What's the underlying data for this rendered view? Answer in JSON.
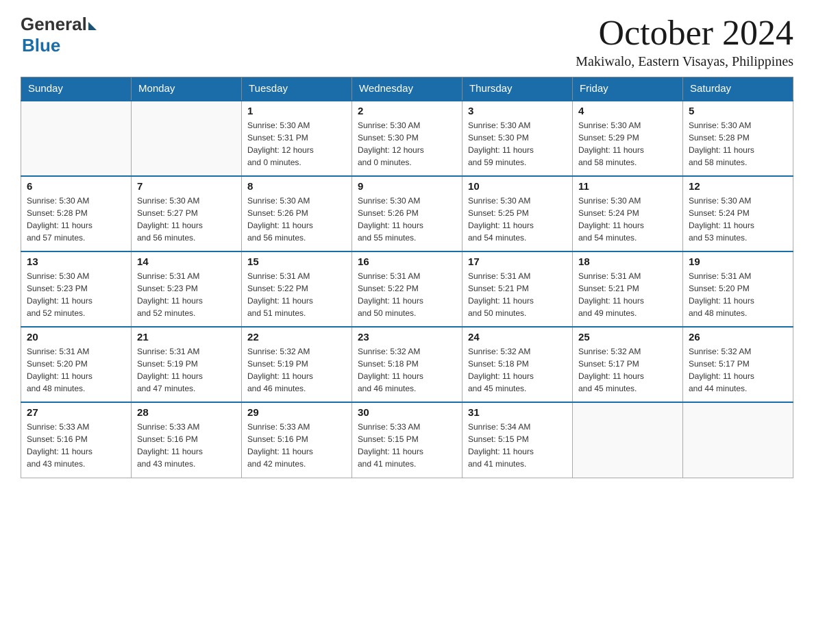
{
  "header": {
    "logo": {
      "general": "General",
      "blue": "Blue"
    },
    "title": "October 2024",
    "subtitle": "Makiwalo, Eastern Visayas, Philippines"
  },
  "calendar": {
    "days_of_week": [
      "Sunday",
      "Monday",
      "Tuesday",
      "Wednesday",
      "Thursday",
      "Friday",
      "Saturday"
    ],
    "weeks": [
      {
        "days": [
          {
            "number": "",
            "info": ""
          },
          {
            "number": "",
            "info": ""
          },
          {
            "number": "1",
            "info": "Sunrise: 5:30 AM\nSunset: 5:31 PM\nDaylight: 12 hours\nand 0 minutes."
          },
          {
            "number": "2",
            "info": "Sunrise: 5:30 AM\nSunset: 5:30 PM\nDaylight: 12 hours\nand 0 minutes."
          },
          {
            "number": "3",
            "info": "Sunrise: 5:30 AM\nSunset: 5:30 PM\nDaylight: 11 hours\nand 59 minutes."
          },
          {
            "number": "4",
            "info": "Sunrise: 5:30 AM\nSunset: 5:29 PM\nDaylight: 11 hours\nand 58 minutes."
          },
          {
            "number": "5",
            "info": "Sunrise: 5:30 AM\nSunset: 5:28 PM\nDaylight: 11 hours\nand 58 minutes."
          }
        ]
      },
      {
        "days": [
          {
            "number": "6",
            "info": "Sunrise: 5:30 AM\nSunset: 5:28 PM\nDaylight: 11 hours\nand 57 minutes."
          },
          {
            "number": "7",
            "info": "Sunrise: 5:30 AM\nSunset: 5:27 PM\nDaylight: 11 hours\nand 56 minutes."
          },
          {
            "number": "8",
            "info": "Sunrise: 5:30 AM\nSunset: 5:26 PM\nDaylight: 11 hours\nand 56 minutes."
          },
          {
            "number": "9",
            "info": "Sunrise: 5:30 AM\nSunset: 5:26 PM\nDaylight: 11 hours\nand 55 minutes."
          },
          {
            "number": "10",
            "info": "Sunrise: 5:30 AM\nSunset: 5:25 PM\nDaylight: 11 hours\nand 54 minutes."
          },
          {
            "number": "11",
            "info": "Sunrise: 5:30 AM\nSunset: 5:24 PM\nDaylight: 11 hours\nand 54 minutes."
          },
          {
            "number": "12",
            "info": "Sunrise: 5:30 AM\nSunset: 5:24 PM\nDaylight: 11 hours\nand 53 minutes."
          }
        ]
      },
      {
        "days": [
          {
            "number": "13",
            "info": "Sunrise: 5:30 AM\nSunset: 5:23 PM\nDaylight: 11 hours\nand 52 minutes."
          },
          {
            "number": "14",
            "info": "Sunrise: 5:31 AM\nSunset: 5:23 PM\nDaylight: 11 hours\nand 52 minutes."
          },
          {
            "number": "15",
            "info": "Sunrise: 5:31 AM\nSunset: 5:22 PM\nDaylight: 11 hours\nand 51 minutes."
          },
          {
            "number": "16",
            "info": "Sunrise: 5:31 AM\nSunset: 5:22 PM\nDaylight: 11 hours\nand 50 minutes."
          },
          {
            "number": "17",
            "info": "Sunrise: 5:31 AM\nSunset: 5:21 PM\nDaylight: 11 hours\nand 50 minutes."
          },
          {
            "number": "18",
            "info": "Sunrise: 5:31 AM\nSunset: 5:21 PM\nDaylight: 11 hours\nand 49 minutes."
          },
          {
            "number": "19",
            "info": "Sunrise: 5:31 AM\nSunset: 5:20 PM\nDaylight: 11 hours\nand 48 minutes."
          }
        ]
      },
      {
        "days": [
          {
            "number": "20",
            "info": "Sunrise: 5:31 AM\nSunset: 5:20 PM\nDaylight: 11 hours\nand 48 minutes."
          },
          {
            "number": "21",
            "info": "Sunrise: 5:31 AM\nSunset: 5:19 PM\nDaylight: 11 hours\nand 47 minutes."
          },
          {
            "number": "22",
            "info": "Sunrise: 5:32 AM\nSunset: 5:19 PM\nDaylight: 11 hours\nand 46 minutes."
          },
          {
            "number": "23",
            "info": "Sunrise: 5:32 AM\nSunset: 5:18 PM\nDaylight: 11 hours\nand 46 minutes."
          },
          {
            "number": "24",
            "info": "Sunrise: 5:32 AM\nSunset: 5:18 PM\nDaylight: 11 hours\nand 45 minutes."
          },
          {
            "number": "25",
            "info": "Sunrise: 5:32 AM\nSunset: 5:17 PM\nDaylight: 11 hours\nand 45 minutes."
          },
          {
            "number": "26",
            "info": "Sunrise: 5:32 AM\nSunset: 5:17 PM\nDaylight: 11 hours\nand 44 minutes."
          }
        ]
      },
      {
        "days": [
          {
            "number": "27",
            "info": "Sunrise: 5:33 AM\nSunset: 5:16 PM\nDaylight: 11 hours\nand 43 minutes."
          },
          {
            "number": "28",
            "info": "Sunrise: 5:33 AM\nSunset: 5:16 PM\nDaylight: 11 hours\nand 43 minutes."
          },
          {
            "number": "29",
            "info": "Sunrise: 5:33 AM\nSunset: 5:16 PM\nDaylight: 11 hours\nand 42 minutes."
          },
          {
            "number": "30",
            "info": "Sunrise: 5:33 AM\nSunset: 5:15 PM\nDaylight: 11 hours\nand 41 minutes."
          },
          {
            "number": "31",
            "info": "Sunrise: 5:34 AM\nSunset: 5:15 PM\nDaylight: 11 hours\nand 41 minutes."
          },
          {
            "number": "",
            "info": ""
          },
          {
            "number": "",
            "info": ""
          }
        ]
      }
    ]
  }
}
